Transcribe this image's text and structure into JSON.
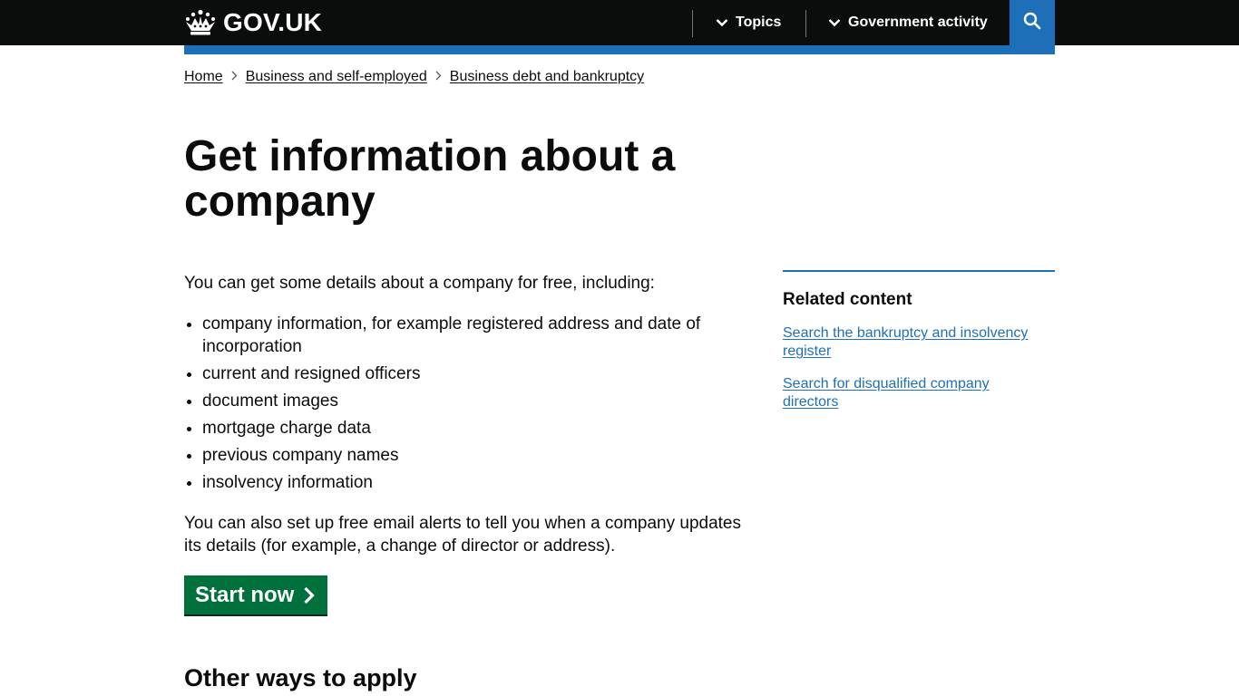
{
  "header": {
    "logo_text": "GOV.UK",
    "nav": {
      "topics_label": "Topics",
      "government_activity_label": "Government activity"
    },
    "colors": {
      "background": "#0b0c0c",
      "accent": "#1d70b8"
    }
  },
  "breadcrumb": {
    "items": [
      "Home",
      "Business and self-employed",
      "Business debt and bankruptcy"
    ]
  },
  "page": {
    "title": "Get information about a company",
    "intro": "You can get some details about a company for free, including:",
    "bullets": [
      "company information, for example registered address and date of incorporation",
      "current and resigned officers",
      "document images",
      "mortgage charge data",
      "previous company names",
      "insolvency information"
    ],
    "alerts_text": "You can also set up free email alerts to tell you when a company updates its details (for example, a change of director or address).",
    "start_button_label": "Start now",
    "start_button_color": "#00703c",
    "other_ways_heading": "Other ways to apply"
  },
  "sidebar": {
    "title": "Related content",
    "links": [
      "Search the bankruptcy and insolvency register",
      "Search for disqualified company directors"
    ]
  },
  "icons": {
    "logo": "crown-icon",
    "nav_toggle": "chevron-down-icon",
    "search": "search-icon",
    "breadcrumb_separator": "chevron-right-icon",
    "start": "arrow-right-icon"
  }
}
